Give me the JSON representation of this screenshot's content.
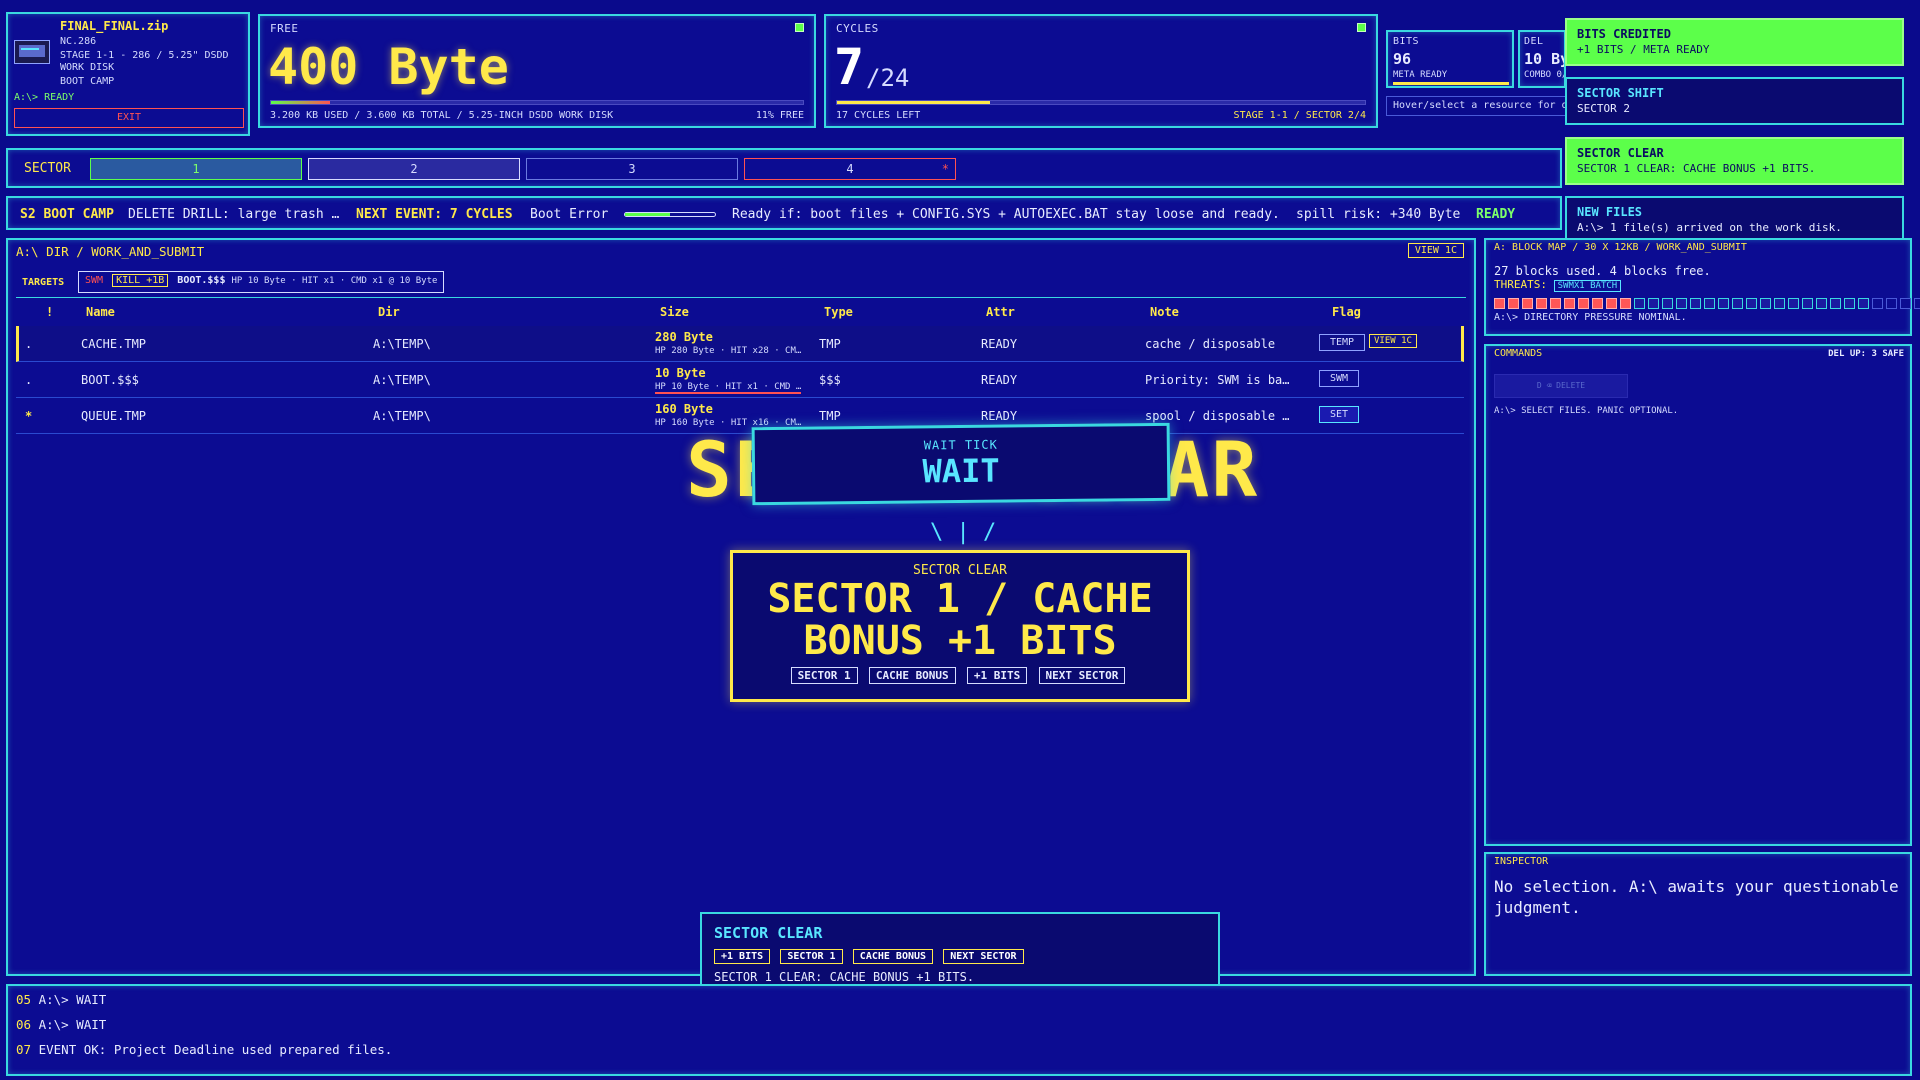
{
  "disk": {
    "filename": "FINAL_FINAL.zip",
    "model": "NC.286",
    "stage": "STAGE 1-1 - 286 / 5.25\" DSDD WORK DISK",
    "mode": "BOOT CAMP",
    "prompt": "A:\\> READY",
    "exit_label": "EXIT"
  },
  "free": {
    "label": "FREE",
    "value": "400 Byte",
    "detail": "3.200 KB USED / 3.600 KB TOTAL / 5.25-INCH DSDD WORK DISK",
    "pct": "11% FREE",
    "used_fraction": 0.89
  },
  "cycles": {
    "label": "CYCLES",
    "value": "7",
    "total": "/24",
    "left": "17 CYCLES LEFT",
    "stage": "STAGE 1-1 / SECTOR 2/4",
    "progress_fraction": 0.29
  },
  "bits": {
    "label": "BITS",
    "value": "96",
    "sub": "META READY"
  },
  "del": {
    "label": "DEL",
    "value": "10 By",
    "sub": "COMBO 0/3"
  },
  "hover_hint": "Hover/select a resource for d",
  "toasts": [
    {
      "title": "BITS CREDITED",
      "body": "+1 BITS / META READY",
      "style": "green"
    },
    {
      "title": "SECTOR SHIFT",
      "body": "SECTOR 2",
      "style": "blue"
    },
    {
      "title": "SECTOR CLEAR",
      "body": "SECTOR 1 CLEAR: CACHE BONUS +1 BITS.",
      "style": "green"
    },
    {
      "title": "NEW FILES",
      "body": "A:\\> 1 file(s) arrived on the work disk.",
      "style": "blue"
    }
  ],
  "sector_tabs": {
    "label": "SECTOR",
    "items": [
      "1",
      "2",
      "3",
      "4"
    ],
    "tab4_mark": "*"
  },
  "ticker": {
    "sector": "S2 BOOT CAMP",
    "drill": "DELETE DRILL: large trash …",
    "next_event": "NEXT EVENT: 7 CYCLES",
    "event_name": "Boot Error",
    "ready_if": "Ready if: boot files + CONFIG.SYS + AUTOEXEC.BAT stay loose and ready.",
    "spill": "spill risk: +340 Byte",
    "status": "READY",
    "event_progress": 0.5
  },
  "dir": {
    "path": "A:\\ DIR / WORK_AND_SUBMIT",
    "view_label": "VIEW 1C",
    "targets_label": "TARGETS",
    "target_tag": "SWM",
    "target_kill": "KILL +1B",
    "target_file": "BOOT.$$$",
    "target_detail": "HP 10 Byte · HIT x1 · CMD x1 @ 10 Byte",
    "columns": [
      "!",
      "Name",
      "Dir",
      "Size",
      "Type",
      "Attr",
      "Note",
      "Flag"
    ],
    "rows": [
      {
        "mark": ".",
        "name": "CACHE.TMP",
        "dir": "A:\\TEMP\\",
        "size": "280 Byte",
        "size_sub": "HP 280 Byte · HIT x28 · CM…",
        "type": "TMP",
        "attr": "READY",
        "note": "cache / disposable",
        "flag": "TEMP",
        "flag2": "VIEW 1C"
      },
      {
        "mark": ".",
        "name": "BOOT.$$$",
        "dir": "A:\\TEMP\\",
        "size": "10 Byte",
        "size_sub": "HP 10 Byte · HIT x1 · CMD …",
        "type": "$$$",
        "attr": "READY",
        "note": "Priority: SWM is ba…",
        "flag": "SWM",
        "flag2": ""
      },
      {
        "mark": "*",
        "name": "QUEUE.TMP",
        "dir": "A:\\TEMP\\",
        "size": "160 Byte",
        "size_sub": "HP 160 Byte · HIT x16 · CM…",
        "type": "TMP",
        "attr": "READY",
        "note": "spool / disposable …",
        "flag": "SET",
        "flag2": ""
      }
    ]
  },
  "big_banner": "SECTOR CLEAR",
  "wait": {
    "small": "WAIT TICK",
    "big": "WAIT"
  },
  "wait_glyph": "\\ | /",
  "clear_popup": {
    "small": "SECTOR CLEAR",
    "line1": "SECTOR 1 / CACHE",
    "line2": "BONUS +1 BITS",
    "chips": [
      "SECTOR 1",
      "CACHE BONUS",
      "+1 BITS",
      "NEXT SECTOR"
    ]
  },
  "clear_card": {
    "title": "SECTOR CLEAR",
    "chips": [
      "+1 BITS",
      "SECTOR 1",
      "CACHE BONUS",
      "NEXT SECTOR"
    ],
    "body": "SECTOR 1 CLEAR: CACHE BONUS +1 BITS."
  },
  "blockmap": {
    "title": "A: BLOCK MAP / 30 X 12KB / WORK_AND_SUBMIT",
    "summary": "27 blocks used. 4 blocks free.",
    "threats_label": "THREATS:",
    "threat": "SWMX1 BATCH",
    "status": "A:\\> DIRECTORY PRESSURE NOMINAL.",
    "used": 10,
    "fileblocks": 17,
    "free": 4
  },
  "commands": {
    "title": "COMMANDS",
    "del_up": "DEL UP: 3 SAFE",
    "delete_label": "D ⌫ DELETE",
    "hint": "A:\\> SELECT FILES. PANIC OPTIONAL."
  },
  "inspector": {
    "title": "INSPECTOR",
    "text": "No selection. A:\\ awaits your questionable judgment."
  },
  "log": [
    {
      "n": "05",
      "t": "A:\\> WAIT"
    },
    {
      "n": "06",
      "t": "A:\\> WAIT"
    },
    {
      "n": "07",
      "t": "EVENT OK: Project Deadline used prepared files."
    }
  ],
  "colors": {
    "bg": "#0a0a8c",
    "accent": "#3ad8e0",
    "yellow": "#ffe94a",
    "green": "#5cff4a",
    "red": "#ff5252"
  }
}
